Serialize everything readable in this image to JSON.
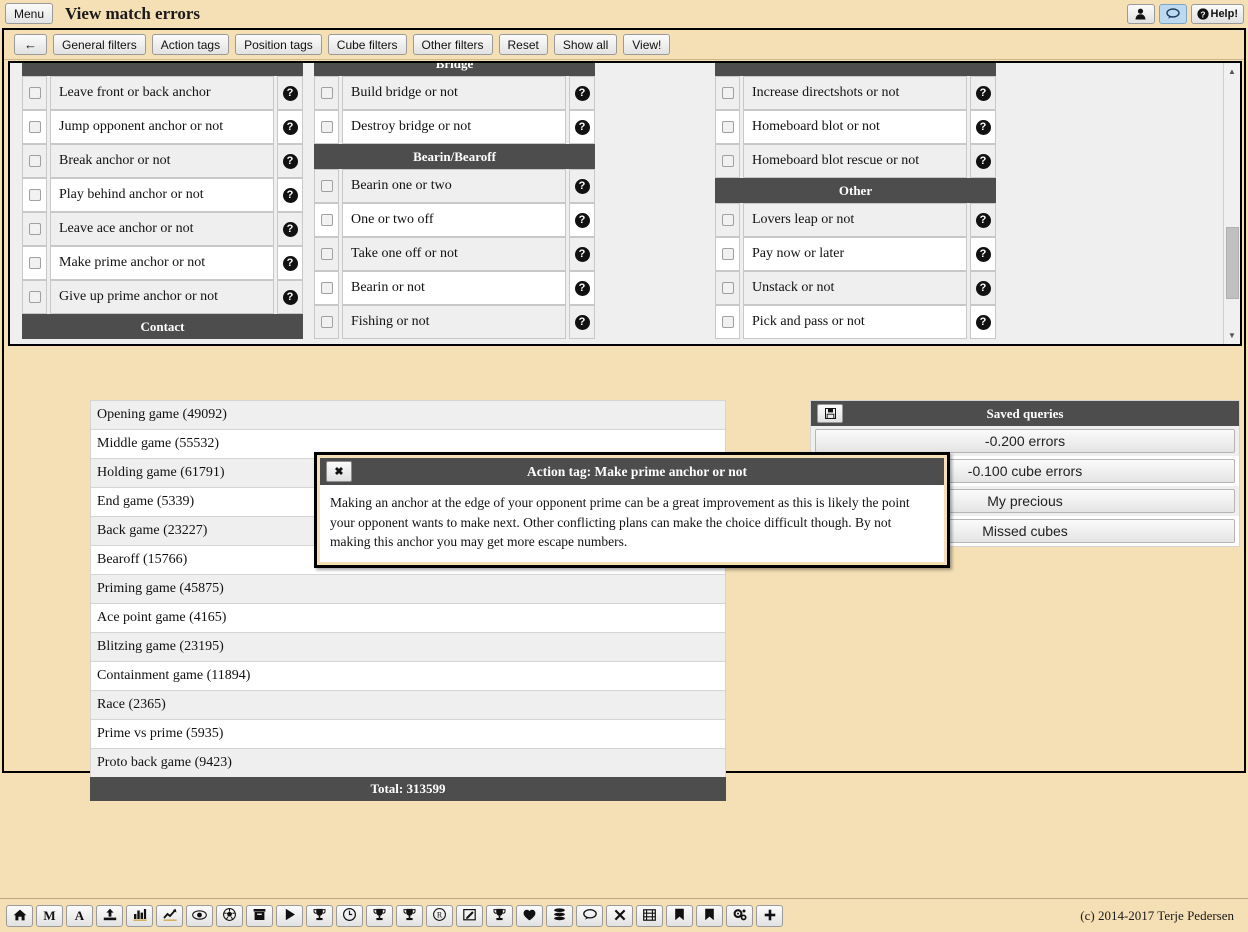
{
  "titlebar": {
    "menu_label": "Menu",
    "page_title": "View match errors",
    "user_icon": "person-icon",
    "chat_icon": "speech-bubble-icon",
    "help_label": "Help!",
    "help_icon": "question-circle-icon"
  },
  "filter_toolbar": {
    "back_label": "←",
    "buttons": [
      "General filters",
      "Action tags",
      "Position tags",
      "Cube filters",
      "Other filters",
      "Reset",
      "Show all",
      "View!"
    ]
  },
  "filter_panel": {
    "columns": [
      {
        "name": "column-1",
        "rows": [
          {
            "type": "header",
            "label": ""
          },
          {
            "type": "item",
            "label": "Leave front or back anchor",
            "checked": false
          },
          {
            "type": "item",
            "label": "Jump opponent anchor or not",
            "checked": false
          },
          {
            "type": "item",
            "label": "Break anchor or not",
            "checked": false
          },
          {
            "type": "item",
            "label": "Play behind anchor or not",
            "checked": false
          },
          {
            "type": "item",
            "label": "Leave ace anchor or not",
            "checked": false
          },
          {
            "type": "item",
            "label": "Make prime anchor or not",
            "checked": false
          },
          {
            "type": "item",
            "label": "Give up prime anchor or not",
            "checked": false
          },
          {
            "type": "header",
            "label": "Contact"
          }
        ]
      },
      {
        "name": "column-2",
        "rows": [
          {
            "type": "header",
            "label": "Bridge"
          },
          {
            "type": "item",
            "label": "Build bridge or not",
            "checked": false
          },
          {
            "type": "item",
            "label": "Destroy bridge or not",
            "checked": false
          },
          {
            "type": "header",
            "label": "Bearin/Bearoff"
          },
          {
            "type": "item",
            "label": "Bearin one or two",
            "checked": false
          },
          {
            "type": "item",
            "label": "One or two off",
            "checked": false
          },
          {
            "type": "item",
            "label": "Take one off or not",
            "checked": false
          },
          {
            "type": "item",
            "label": "Bearin or not",
            "checked": false
          },
          {
            "type": "item",
            "label": "Fishing or not",
            "checked": false
          }
        ]
      },
      {
        "name": "column-3",
        "rows": [
          {
            "type": "header",
            "label": ""
          },
          {
            "type": "item",
            "label": "Increase directshots or not",
            "checked": false
          },
          {
            "type": "item",
            "label": "Homeboard blot or not",
            "checked": false
          },
          {
            "type": "item",
            "label": "Homeboard blot rescue or not",
            "checked": false
          },
          {
            "type": "header",
            "label": "Other"
          },
          {
            "type": "item",
            "label": "Lovers leap or not",
            "checked": false
          },
          {
            "type": "item",
            "label": "Pay now or later",
            "checked": false
          },
          {
            "type": "item",
            "label": "Unstack or not",
            "checked": false
          },
          {
            "type": "item",
            "label": "Pick and pass or not",
            "checked": false
          }
        ]
      }
    ],
    "scrollbar": {
      "up_arrow": "▲",
      "down_arrow": "▼"
    }
  },
  "position_list": {
    "rows": [
      "Opening game (49092)",
      "Middle game (55532)",
      "Holding game (61791)",
      "End game (5339)",
      "Back game (23227)",
      "Bearoff (15766)",
      "Priming game (45875)",
      "Ace point game (4165)",
      "Blitzing game (23195)",
      "Containment game (11894)",
      "Race (2365)",
      "Prime vs prime (5935)",
      "Proto back game (9423)"
    ],
    "total": "Total: 313599"
  },
  "saved_queries": {
    "title": "Saved queries",
    "save_icon": "floppy-disk-icon",
    "items": [
      "-0.200 errors",
      "-0.100 cube errors",
      "My precious",
      "Missed cubes"
    ]
  },
  "popup": {
    "close_label": "✖",
    "title": "Action tag: Make prime anchor or not",
    "body": "Making an anchor at the edge of your opponent prime can be a great improvement as this is likely the point your opponent wants to make next. Other conflicting plans can make the choice difficult though. By not making this anchor you may get more escape numbers."
  },
  "bottom_toolbar": {
    "icons": [
      "home-icon",
      "M",
      "A",
      "upload-icon",
      "bar-chart-icon",
      "line-chart-icon",
      "eye-icon",
      "soccer-ball-icon",
      "archive-box-icon",
      "play-icon",
      "trophy-icon",
      "clock-icon",
      "trophy-icon",
      "trophy-icon",
      "registered-icon",
      "edit-square-icon",
      "trophy-icon",
      "heart-icon",
      "database-icon",
      "speech-bubble-icon",
      "close-x-icon",
      "film-icon",
      "bookmark-icon",
      "bookmark-icon",
      "gears-icon",
      "plus-icon"
    ],
    "copyright": "(c) 2014-2017 Terje Pedersen"
  },
  "colors": {
    "background": "#f5dfb4",
    "panel_bg": "#efefef",
    "header_dark": "#4d4d4d",
    "accent_active": "#bcd9ef"
  }
}
